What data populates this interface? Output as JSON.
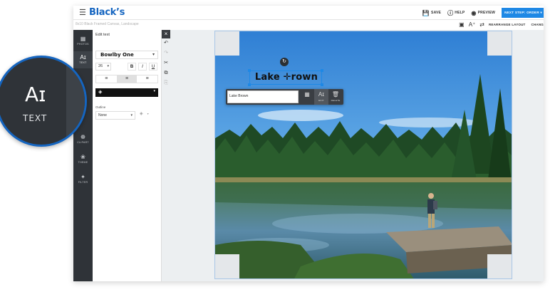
{
  "app": {
    "brand": "Black’s",
    "breadcrumb": "8x10 Black Framed Canvas, Landscape"
  },
  "topbar": {
    "menu_icon": "hamburger-icon",
    "actions": [
      {
        "label": "SAVE",
        "icon": "save-icon"
      },
      {
        "label": "HELP",
        "icon": "help-icon"
      },
      {
        "label": "PREVIEW",
        "icon": "eye-icon"
      }
    ],
    "buy_label": "NEXT STEP: ORDER ▾"
  },
  "subbar": {
    "rearrange_label": "REARRANGE LAYOUT",
    "change_label": "CHANG"
  },
  "rail": {
    "items": [
      {
        "label": "PHOTOS",
        "icon": "photos-icon"
      },
      {
        "label": "TEXT",
        "icon": "text-icon",
        "active": true
      },
      {
        "label": "CLIPART",
        "icon": "clipart-icon"
      },
      {
        "label": "THEME",
        "icon": "palette-icon"
      },
      {
        "label": "FILTER",
        "icon": "sparkle-icon"
      }
    ]
  },
  "panel": {
    "title": "Edit text",
    "font": "Bowlby One",
    "size": "26",
    "bold": "B",
    "italic": "I",
    "underline": "U",
    "outline_label": "Outline",
    "outline_value": "None",
    "text_color": "#111111"
  },
  "canvas": {
    "text": "Lake Brown",
    "text_display": "Lake ✛rown",
    "input_value": "Lake Brown",
    "popup": [
      {
        "label": "",
        "icon": "grid-icon"
      },
      {
        "label": "EDIT",
        "icon": "text-edit-icon"
      },
      {
        "label": "DELETE",
        "icon": "trash-icon"
      }
    ]
  },
  "callout": {
    "label": "TEXT",
    "icon": "text-icon"
  },
  "colors": {
    "brand": "#1565c0",
    "accent": "#1e88e5",
    "rail": "#2f3338"
  }
}
